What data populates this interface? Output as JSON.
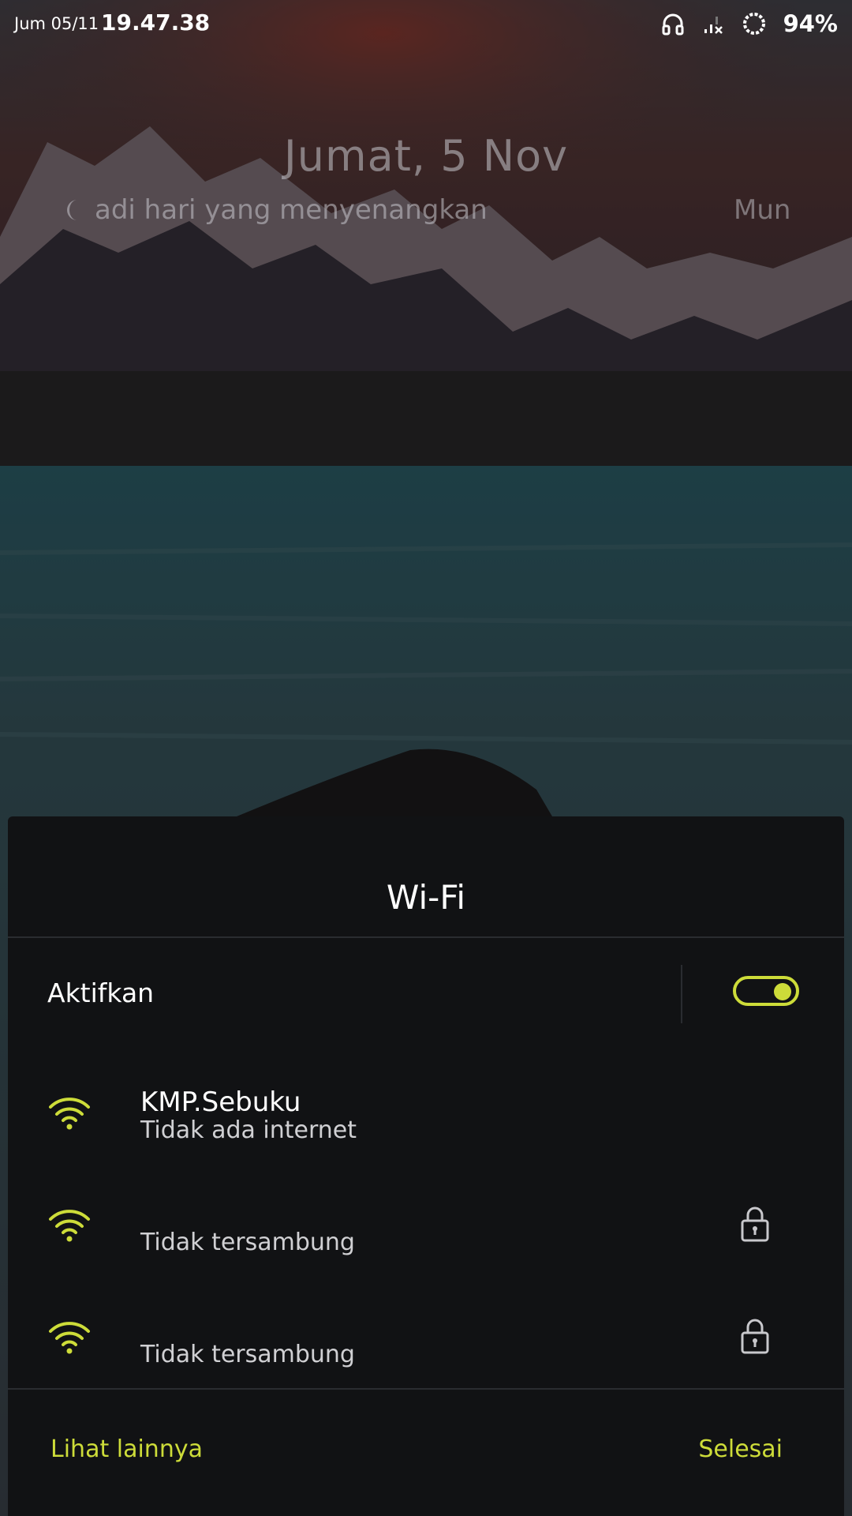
{
  "status_bar": {
    "date": "Jum 05/11",
    "time": "19.47.38",
    "battery": "94%",
    "icons": [
      "headphones-icon",
      "signal-no-service-icon",
      "battery-ring-icon"
    ]
  },
  "lockscreen": {
    "date": "Jumat, 5 Nov",
    "greeting": "adi hari yang menyenangkan",
    "greeting_tail": "Mun"
  },
  "wifi_dialog": {
    "title": "Wi-Fi",
    "enable_label": "Aktifkan",
    "enabled": true,
    "networks": [
      {
        "name": "KMP.Sebuku",
        "status": "Tidak ada internet",
        "secured": false
      },
      {
        "name": "",
        "status": "Tidak tersambung",
        "secured": true
      },
      {
        "name": "",
        "status": "Tidak tersambung",
        "secured": true
      }
    ],
    "more_label": "Lihat lainnya",
    "done_label": "Selesai"
  },
  "colors": {
    "accent": "#cddc39",
    "dialog_bg": "#111214",
    "divider": "#2a2c30"
  }
}
